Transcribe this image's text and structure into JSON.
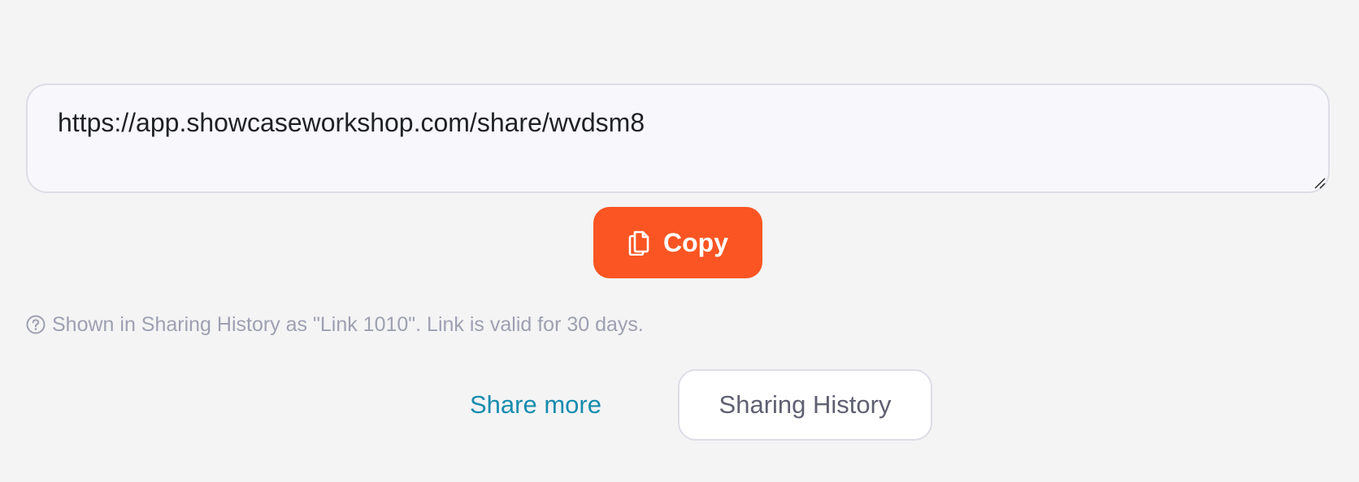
{
  "share": {
    "link_url": "https://app.showcaseworkshop.com/share/wvdsm8",
    "copy_label": "Copy",
    "info_text": "Shown in Sharing History as \"Link 1010\". Link is valid for 30 days.",
    "share_more_label": "Share more",
    "history_label": "Sharing History"
  },
  "icons": {
    "copy": "copy-documents-icon",
    "help": "question-circle-icon",
    "resize": "resize-grip-icon"
  },
  "colors": {
    "background": "#f4f4f5",
    "accent": "#fa5523",
    "link": "#178cae",
    "muted_text": "#9ea0b2",
    "border": "#dcdde6"
  }
}
